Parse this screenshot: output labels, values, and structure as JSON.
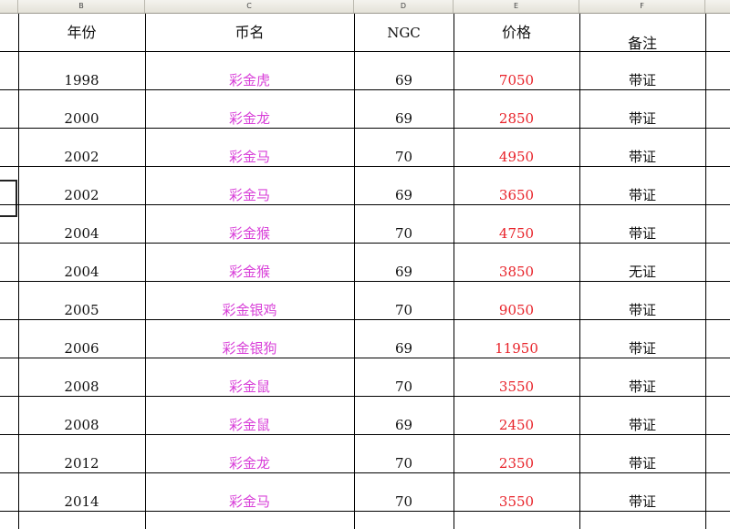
{
  "column_letters": [
    "B",
    "C",
    "D",
    "E",
    "F"
  ],
  "headers": {
    "year": "年份",
    "name": "币名",
    "grade": "NGC",
    "price": "价格",
    "note": "备注"
  },
  "rows": [
    {
      "year": "1998",
      "name": "彩金虎",
      "grade": "69",
      "price": "7050",
      "note": "带证"
    },
    {
      "year": "2000",
      "name": "彩金龙",
      "grade": "69",
      "price": "2850",
      "note": "带证"
    },
    {
      "year": "2002",
      "name": "彩金马",
      "grade": "70",
      "price": "4950",
      "note": "带证"
    },
    {
      "year": "2002",
      "name": "彩金马",
      "grade": "69",
      "price": "3650",
      "note": "带证"
    },
    {
      "year": "2004",
      "name": "彩金猴",
      "grade": "70",
      "price": "4750",
      "note": "带证"
    },
    {
      "year": "2004",
      "name": "彩金猴",
      "grade": "69",
      "price": "3850",
      "note": "无证"
    },
    {
      "year": "2005",
      "name": "彩金银鸡",
      "grade": "70",
      "price": "9050",
      "note": "带证"
    },
    {
      "year": "2006",
      "name": "彩金银狗",
      "grade": "69",
      "price": "11950",
      "note": "带证"
    },
    {
      "year": "2008",
      "name": "彩金鼠",
      "grade": "70",
      "price": "3550",
      "note": "带证"
    },
    {
      "year": "2008",
      "name": "彩金鼠",
      "grade": "69",
      "price": "2450",
      "note": "带证"
    },
    {
      "year": "2012",
      "name": "彩金龙",
      "grade": "70",
      "price": "2350",
      "note": "带证"
    },
    {
      "year": "2014",
      "name": "彩金马",
      "grade": "70",
      "price": "3550",
      "note": "带证"
    }
  ],
  "colors": {
    "name_text": "#d83fd8",
    "price_text": "#e8232a",
    "grid_line": "#000000"
  }
}
